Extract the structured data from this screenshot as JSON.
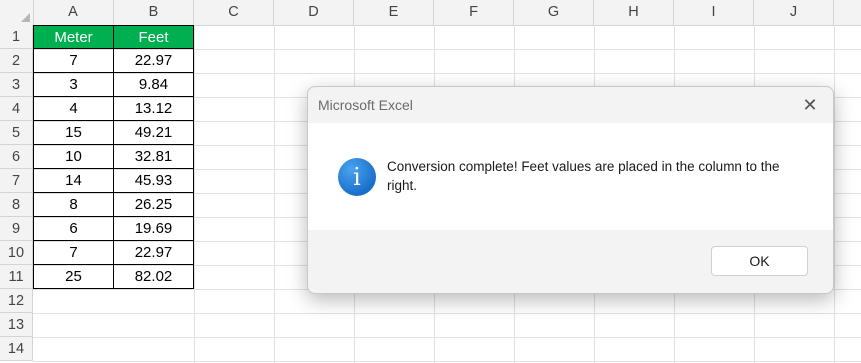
{
  "columns": [
    "A",
    "B",
    "C",
    "D",
    "E",
    "F",
    "G",
    "H",
    "I",
    "J"
  ],
  "rows": [
    "1",
    "2",
    "3",
    "4",
    "5",
    "6",
    "7",
    "8",
    "9",
    "10",
    "11",
    "12",
    "13",
    "14"
  ],
  "table": {
    "header": [
      "Meter",
      "Feet"
    ],
    "data": [
      [
        "7",
        "22.97"
      ],
      [
        "3",
        "9.84"
      ],
      [
        "4",
        "13.12"
      ],
      [
        "15",
        "49.21"
      ],
      [
        "10",
        "32.81"
      ],
      [
        "14",
        "45.93"
      ],
      [
        "8",
        "26.25"
      ],
      [
        "6",
        "19.69"
      ],
      [
        "7",
        "22.97"
      ],
      [
        "25",
        "82.02"
      ]
    ]
  },
  "colors": {
    "header_fill": "#00b050",
    "header_text": "#ffffff",
    "info_icon": "#1a6fc9"
  },
  "dialog": {
    "title": "Microsoft Excel",
    "close_glyph": "✕",
    "icon": "info-icon",
    "icon_glyph": "i",
    "message": "Conversion complete! Feet values are placed in the column to the right.",
    "ok_label": "OK"
  }
}
